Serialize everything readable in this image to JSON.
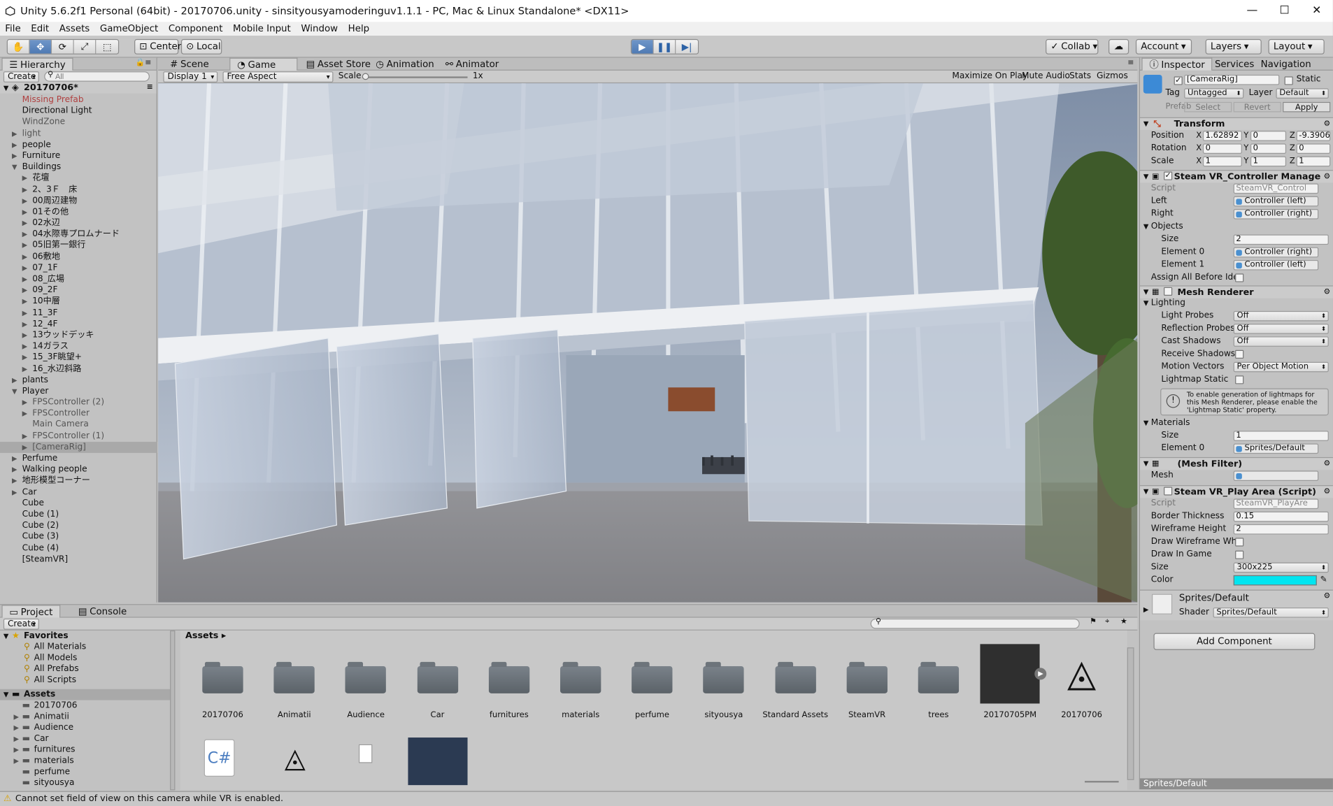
{
  "window": {
    "title": "Unity 5.6.2f1 Personal (64bit) - 20170706.unity - sinsityousyamoderinguv1.1.1 - PC, Mac & Linux Standalone* <DX11>",
    "controls": [
      "minimize",
      "maximize",
      "close"
    ]
  },
  "menu": [
    "File",
    "Edit",
    "Assets",
    "GameObject",
    "Component",
    "Mobile Input",
    "Window",
    "Help"
  ],
  "toolbar": {
    "pivot": "Center",
    "space": "Local",
    "collab": "Collab",
    "account": "Account",
    "layers": "Layers",
    "layout": "Layout"
  },
  "hierarchy": {
    "tab": "Hierarchy",
    "create": "Create",
    "search_placeholder": "All",
    "scene": "20170706*",
    "items": [
      {
        "label": "Missing Prefab",
        "indent": 1,
        "style": "red"
      },
      {
        "label": "Directional Light",
        "indent": 1
      },
      {
        "label": "WindZone",
        "indent": 1,
        "style": "gray"
      },
      {
        "label": "light",
        "indent": 1,
        "arrow": "right",
        "style": "gray"
      },
      {
        "label": "people",
        "indent": 1,
        "arrow": "right"
      },
      {
        "label": "Furniture",
        "indent": 1,
        "arrow": "right"
      },
      {
        "label": "Buildings",
        "indent": 1,
        "arrow": "down"
      },
      {
        "label": "花壇",
        "indent": 2,
        "arrow": "right"
      },
      {
        "label": "2、3Ｆ　床",
        "indent": 2,
        "arrow": "right"
      },
      {
        "label": "00周辺建物",
        "indent": 2,
        "arrow": "right"
      },
      {
        "label": "01その他",
        "indent": 2,
        "arrow": "right"
      },
      {
        "label": "02水辺",
        "indent": 2,
        "arrow": "right"
      },
      {
        "label": "04水際専プロムナード",
        "indent": 2,
        "arrow": "right"
      },
      {
        "label": "05旧第一銀行",
        "indent": 2,
        "arrow": "right"
      },
      {
        "label": "06敷地",
        "indent": 2,
        "arrow": "right"
      },
      {
        "label": "07_1F",
        "indent": 2,
        "arrow": "right"
      },
      {
        "label": "08_広場",
        "indent": 2,
        "arrow": "right"
      },
      {
        "label": "09_2F",
        "indent": 2,
        "arrow": "right"
      },
      {
        "label": "10中層",
        "indent": 2,
        "arrow": "right"
      },
      {
        "label": "11_3F",
        "indent": 2,
        "arrow": "right"
      },
      {
        "label": "12_4F",
        "indent": 2,
        "arrow": "right"
      },
      {
        "label": "13ウッドデッキ",
        "indent": 2,
        "arrow": "right"
      },
      {
        "label": "14ガラス",
        "indent": 2,
        "arrow": "right"
      },
      {
        "label": "15_3F眺望+",
        "indent": 2,
        "arrow": "right"
      },
      {
        "label": "16_水辺斜路",
        "indent": 2,
        "arrow": "right"
      },
      {
        "label": "plants",
        "indent": 1,
        "arrow": "right"
      },
      {
        "label": "Player",
        "indent": 1,
        "arrow": "down"
      },
      {
        "label": "FPSController (2)",
        "indent": 2,
        "arrow": "right",
        "style": "gray"
      },
      {
        "label": "FPSController",
        "indent": 2,
        "arrow": "right",
        "style": "gray"
      },
      {
        "label": "Main Camera",
        "indent": 2,
        "style": "gray"
      },
      {
        "label": "FPSController (1)",
        "indent": 2,
        "arrow": "right",
        "style": "gray"
      },
      {
        "label": "[CameraRig]",
        "indent": 2,
        "arrow": "right",
        "style": "gray",
        "selected": true
      },
      {
        "label": "Perfume",
        "indent": 1,
        "arrow": "right"
      },
      {
        "label": "Walking people",
        "indent": 1,
        "arrow": "right"
      },
      {
        "label": "地形模型コーナー",
        "indent": 1,
        "arrow": "right"
      },
      {
        "label": "Car",
        "indent": 1,
        "arrow": "right"
      },
      {
        "label": "Cube",
        "indent": 1
      },
      {
        "label": "Cube (1)",
        "indent": 1
      },
      {
        "label": "Cube (2)",
        "indent": 1
      },
      {
        "label": "Cube (3)",
        "indent": 1
      },
      {
        "label": "Cube (4)",
        "indent": 1
      },
      {
        "label": "[SteamVR]",
        "indent": 1
      }
    ]
  },
  "center_tabs": {
    "scene": "Scene",
    "game": "Game",
    "asset_store": "Asset Store",
    "animation": "Animation",
    "animator": "Animator"
  },
  "game_bar": {
    "display": "Display 1",
    "aspect": "Free Aspect",
    "scale_label": "Scale",
    "scale_value": "1x",
    "maximize": "Maximize On Play",
    "mute": "Mute Audio",
    "stats": "Stats",
    "gizmos": "Gizmos"
  },
  "inspector": {
    "tabs": {
      "inspector": "Inspector",
      "services": "Services",
      "navigation": "Navigation"
    },
    "name": "[CameraRig]",
    "static": "Static",
    "tag_label": "Tag",
    "tag": "Untagged",
    "layer_label": "Layer",
    "layer": "Default",
    "prefab_label": "Prefab",
    "select": "Select",
    "revert": "Revert",
    "apply": "Apply",
    "transform": {
      "title": "Transform",
      "position": "Position",
      "rotation": "Rotation",
      "scale": "Scale",
      "pos": [
        "1.62892",
        "0",
        "-9.3906"
      ],
      "rot": [
        "0",
        "0",
        "0"
      ],
      "scl": [
        "1",
        "1",
        "1"
      ],
      "x": "X",
      "y": "Y",
      "z": "Z"
    },
    "steam_ctrl": {
      "title": "Steam VR_Controller Manage",
      "script": "Script",
      "script_val": "SteamVR_Control",
      "left": "Left",
      "left_val": "Controller (left)",
      "right": "Right",
      "right_val": "Controller (right)",
      "objects": "Objects",
      "size": "Size",
      "size_val": "2",
      "e0": "Element 0",
      "e0_val": "Controller (right)",
      "e1": "Element 1",
      "e1_val": "Controller (left)",
      "assign": "Assign All Before Ide"
    },
    "mesh_renderer": {
      "title": "Mesh Renderer",
      "lighting": "Lighting",
      "light_probes": "Light Probes",
      "light_probes_val": "Off",
      "reflection": "Reflection Probes",
      "reflection_val": "Off",
      "cast": "Cast Shadows",
      "cast_val": "Off",
      "receive": "Receive Shadows",
      "motion": "Motion Vectors",
      "motion_val": "Per Object Motion",
      "lightmap": "Lightmap Static",
      "info": "To enable generation of lightmaps for this Mesh Renderer, please enable the 'Lightmap Static' property.",
      "materials": "Materials",
      "size": "Size",
      "size_val": "1",
      "e0": "Element 0",
      "e0_val": "Sprites/Default"
    },
    "mesh_filter": {
      "title": "(Mesh Filter)",
      "mesh": "Mesh"
    },
    "play_area": {
      "title": "Steam VR_Play Area (Script)",
      "script": "Script",
      "script_val": "SteamVR_PlayAre",
      "border": "Border Thickness",
      "border_val": "0.15",
      "wire": "Wireframe Height",
      "wire_val": "2",
      "draw_wire": "Draw Wireframe Wh",
      "draw_game": "Draw In Game",
      "size": "Size",
      "size_val": "300x225",
      "color": "Color",
      "color_val": "#00e5f0"
    },
    "material": {
      "name": "Sprites/Default",
      "shader_label": "Shader",
      "shader": "Sprites/Default"
    },
    "add_component": "Add Component",
    "preview": "Sprites/Default"
  },
  "project": {
    "tab": "Project",
    "console": "Console",
    "create": "Create",
    "breadcrumb": "Assets",
    "favorites": "Favorites",
    "fav_items": [
      "All Materials",
      "All Models",
      "All Prefabs",
      "All Scripts"
    ],
    "assets_root": "Assets",
    "tree": [
      "20170706",
      "Animatii",
      "Audience",
      "Car",
      "furnitures",
      "materials",
      "perfume",
      "sityousya"
    ],
    "grid": [
      "20170706",
      "Animatii",
      "Audience",
      "Car",
      "furnitures",
      "materials",
      "perfume",
      "sityousya",
      "Standard Assets",
      "SteamVR",
      "trees",
      "20170705PM",
      "20170706"
    ]
  },
  "status": "Cannot set field of view on this camera while VR is enabled."
}
